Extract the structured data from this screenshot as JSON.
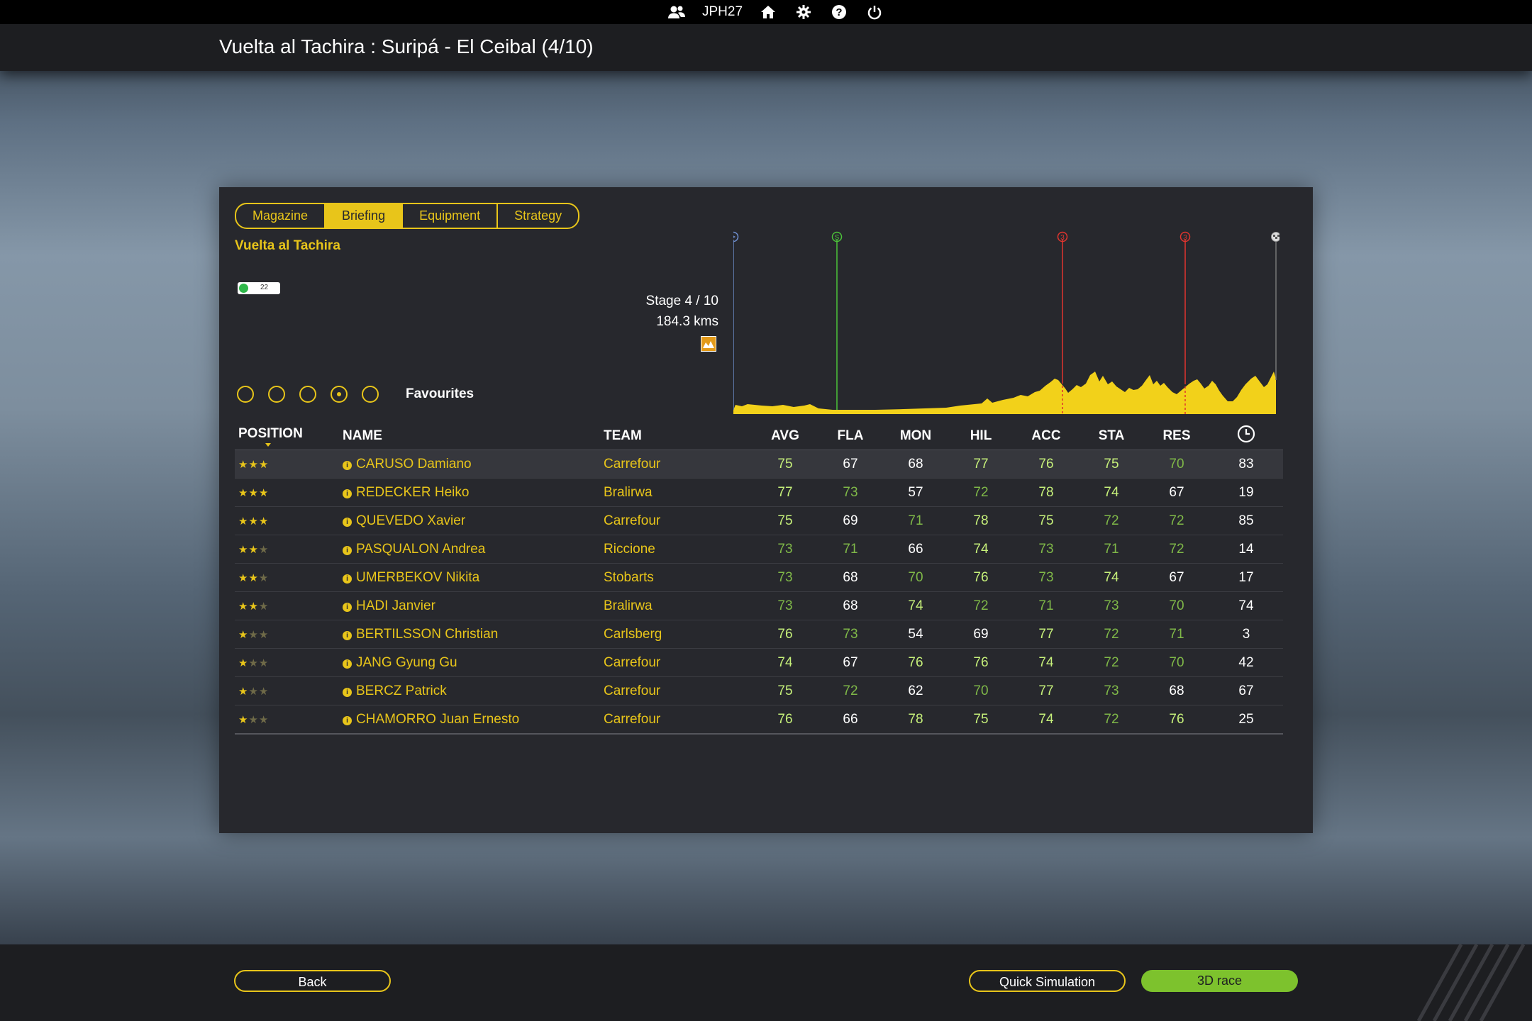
{
  "topbar": {
    "username": "JPH27"
  },
  "header": {
    "title": "Vuelta al Tachira : Suripá - El Ceibal (4/10)"
  },
  "tabs": [
    "Magazine",
    "Briefing",
    "Equipment",
    "Strategy"
  ],
  "active_tab": "Briefing",
  "race": {
    "name": "Vuelta al Tachira",
    "toggle_value": "22"
  },
  "stage": {
    "number": "Stage 4 / 10",
    "distance": "184.3 kms"
  },
  "profile_markers": [
    {
      "type": "start",
      "color": "#6f8fd0",
      "label": "▸"
    },
    {
      "type": "sprint",
      "color": "#4cc23a",
      "label": "S"
    },
    {
      "type": "climb",
      "color": "#e0342e",
      "label": "3"
    },
    {
      "type": "climb",
      "color": "#e0342e",
      "label": "3"
    },
    {
      "type": "finish",
      "color": "#bbbbbb",
      "label": ""
    }
  ],
  "filters": {
    "label": "Favourites",
    "options": 5,
    "selected": 4
  },
  "table": {
    "columns": [
      "POSITION",
      "NAME",
      "TEAM",
      "AVG",
      "FLA",
      "MON",
      "HIL",
      "ACC",
      "STA",
      "RES",
      ""
    ],
    "rows": [
      {
        "stars": 3,
        "name": "CARUSO Damiano",
        "team": "Carrefour",
        "avg": "75",
        "fla": "67",
        "mon": "68",
        "hil": "77",
        "acc": "76",
        "sta": "75",
        "res": "70",
        "time": "83"
      },
      {
        "stars": 3,
        "name": "REDECKER Heiko",
        "team": "Bralirwa",
        "avg": "77",
        "fla": "73",
        "mon": "57",
        "hil": "72",
        "acc": "78",
        "sta": "74",
        "res": "67",
        "time": "19"
      },
      {
        "stars": 3,
        "name": "QUEVEDO Xavier",
        "team": "Carrefour",
        "avg": "75",
        "fla": "69",
        "mon": "71",
        "hil": "78",
        "acc": "75",
        "sta": "72",
        "res": "72",
        "time": "85"
      },
      {
        "stars": 2,
        "name": "PASQUALON Andrea",
        "team": "Riccione",
        "avg": "73",
        "fla": "71",
        "mon": "66",
        "hil": "74",
        "acc": "73",
        "sta": "71",
        "res": "72",
        "time": "14"
      },
      {
        "stars": 2,
        "name": "UMERBEKOV Nikita",
        "team": "Stobarts",
        "avg": "73",
        "fla": "68",
        "mon": "70",
        "hil": "76",
        "acc": "73",
        "sta": "74",
        "res": "67",
        "time": "17"
      },
      {
        "stars": 2,
        "name": "HADI Janvier",
        "team": "Bralirwa",
        "avg": "73",
        "fla": "68",
        "mon": "74",
        "hil": "72",
        "acc": "71",
        "sta": "73",
        "res": "70",
        "time": "74"
      },
      {
        "stars": 1,
        "name": "BERTILSSON Christian",
        "team": "Carlsberg",
        "avg": "76",
        "fla": "73",
        "mon": "54",
        "hil": "69",
        "acc": "77",
        "sta": "72",
        "res": "71",
        "time": "3"
      },
      {
        "stars": 1,
        "name": "JANG Gyung Gu",
        "team": "Carrefour",
        "avg": "74",
        "fla": "67",
        "mon": "76",
        "hil": "76",
        "acc": "74",
        "sta": "72",
        "res": "70",
        "time": "42"
      },
      {
        "stars": 1,
        "name": "BERCZ Patrick",
        "team": "Carrefour",
        "avg": "75",
        "fla": "72",
        "mon": "62",
        "hil": "70",
        "acc": "77",
        "sta": "73",
        "res": "68",
        "time": "67"
      },
      {
        "stars": 1,
        "name": "CHAMORRO Juan Ernesto",
        "team": "Carrefour",
        "avg": "76",
        "fla": "66",
        "mon": "78",
        "hil": "75",
        "acc": "74",
        "sta": "72",
        "res": "76",
        "time": "25"
      }
    ]
  },
  "buttons": {
    "back": "Back",
    "quick_sim": "Quick Simulation",
    "race_3d": "3D race"
  },
  "colors": {
    "accent": "#e8c51a",
    "green": "#7dc22d",
    "panel": "#27282d"
  }
}
